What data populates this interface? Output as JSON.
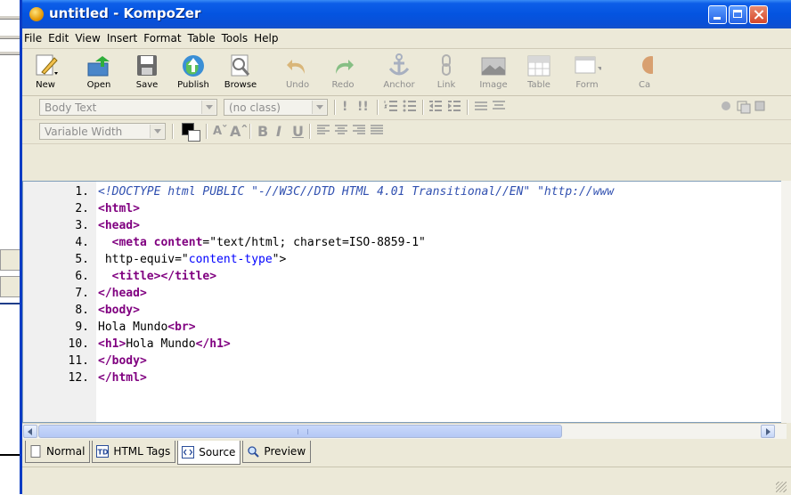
{
  "window": {
    "title": "untitled - KompoZer",
    "controls": [
      "minimize-icon",
      "maximize-icon",
      "close-icon"
    ]
  },
  "menu": [
    "File",
    "Edit",
    "View",
    "Insert",
    "Format",
    "Table",
    "Tools",
    "Help"
  ],
  "toolbar": {
    "buttons": [
      {
        "label": "New",
        "icon": "new-icon",
        "enabled": true
      },
      {
        "label": "Open",
        "icon": "open-icon",
        "enabled": true
      },
      {
        "label": "Save",
        "icon": "save-icon",
        "enabled": true
      },
      {
        "label": "Publish",
        "icon": "publish-icon",
        "enabled": true
      },
      {
        "label": "Browse",
        "icon": "browse-icon",
        "enabled": true
      },
      {
        "label": "Undo",
        "icon": "undo-icon",
        "enabled": false
      },
      {
        "label": "Redo",
        "icon": "redo-icon",
        "enabled": false
      },
      {
        "label": "Anchor",
        "icon": "anchor-icon",
        "enabled": false
      },
      {
        "label": "Link",
        "icon": "link-icon",
        "enabled": false
      },
      {
        "label": "Image",
        "icon": "image-icon",
        "enabled": false
      },
      {
        "label": "Table",
        "icon": "table-icon",
        "enabled": false
      },
      {
        "label": "Form",
        "icon": "form-icon",
        "enabled": false
      },
      {
        "label": "Ca",
        "icon": "css-icon",
        "enabled": false
      }
    ]
  },
  "format1": {
    "paragraph_style": "Body Text",
    "class": "(no class)"
  },
  "format2": {
    "font": "Variable Width"
  },
  "editor": {
    "lines": [
      {
        "n": "1.",
        "html": "<span class=\"doc\">&lt;!DOCTYPE html PUBLIC \"-//W3C//DTD HTML 4.01 Transitional//EN\" \"http://www</span>"
      },
      {
        "n": "2.",
        "html": "<span class=\"tag\">&lt;html&gt;</span>"
      },
      {
        "n": "3.",
        "html": "<span class=\"tag\">&lt;head&gt;</span>"
      },
      {
        "n": "4.",
        "html": "  <span class=\"tag\">&lt;meta</span> <span class=\"tag\">content</span>=<span class=\"attr\">\"text/html; charset=ISO-8859-1\"</span>"
      },
      {
        "n": "5.",
        "html": " http-equiv=\"<span class=\"val\">content-type</span>\"&gt;"
      },
      {
        "n": "6.",
        "html": "  <span class=\"tag\">&lt;title&gt;&lt;/title&gt;</span>"
      },
      {
        "n": "7.",
        "html": "<span class=\"tag\">&lt;/head&gt;</span>"
      },
      {
        "n": "8.",
        "html": "<span class=\"tag\">&lt;body&gt;</span>"
      },
      {
        "n": "9.",
        "html": "Hola Mundo<span class=\"tag\">&lt;br&gt;</span>"
      },
      {
        "n": "10.",
        "html": "<span class=\"tag\">&lt;h1&gt;</span>Hola Mundo<span class=\"tag\">&lt;/h1&gt;</span>"
      },
      {
        "n": "11.",
        "html": "<span class=\"tag\">&lt;/body&gt;</span>"
      },
      {
        "n": "12.",
        "html": "<span class=\"tag\">&lt;/html&gt;</span>"
      }
    ]
  },
  "tabs": [
    {
      "label": "Normal",
      "icon": "normal-page-icon",
      "active": false
    },
    {
      "label": "HTML Tags",
      "icon": "html-tags-icon",
      "active": false
    },
    {
      "label": "Source",
      "icon": "source-icon",
      "active": true
    },
    {
      "label": "Preview",
      "icon": "preview-icon",
      "active": false
    }
  ],
  "colors": {
    "titlebar": "#0454e0",
    "tag": "#800080",
    "value": "#0000ff",
    "doctype": "#3050b0"
  }
}
